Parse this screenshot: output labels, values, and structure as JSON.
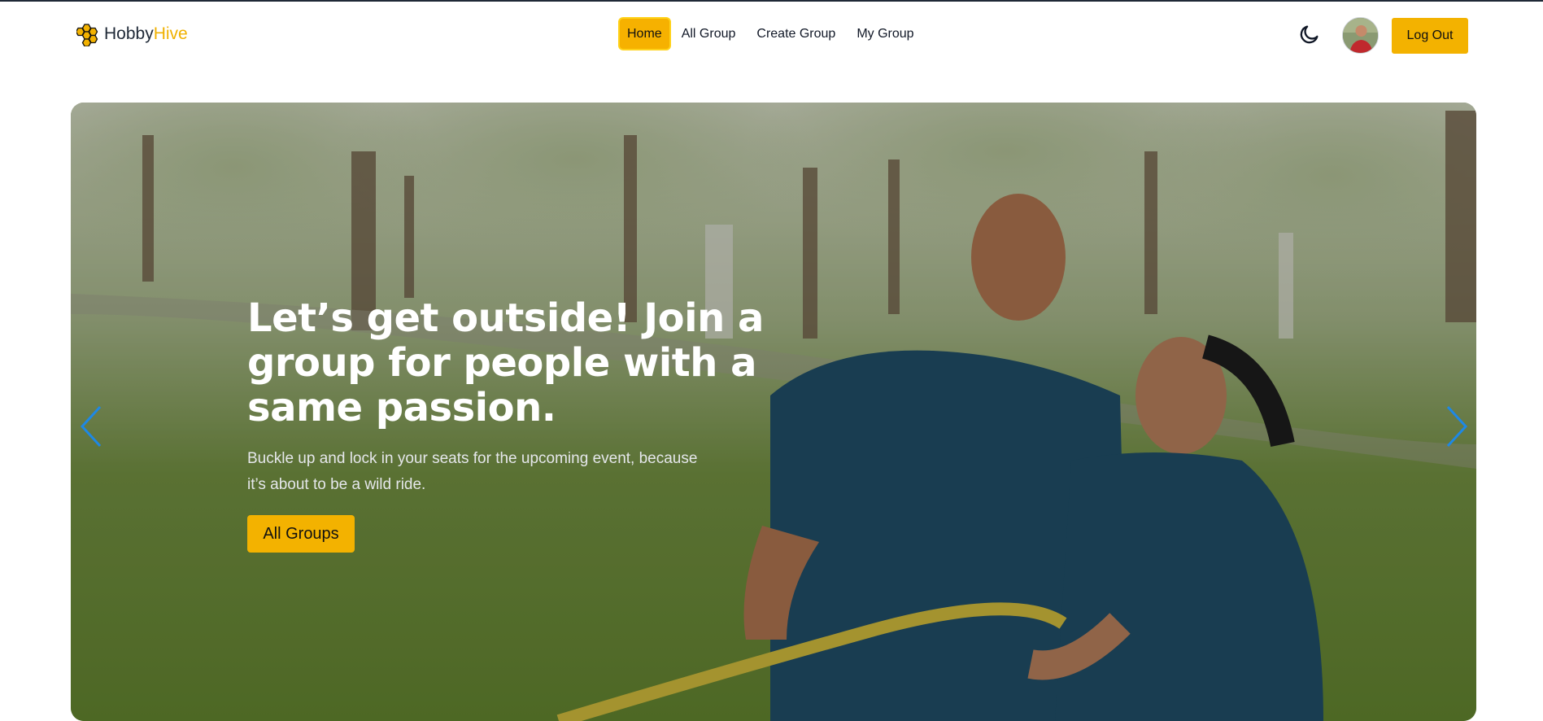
{
  "brand": {
    "name_part1": "Hobby",
    "name_part2": "Hive"
  },
  "nav": {
    "items": [
      {
        "label": "Home",
        "active": true
      },
      {
        "label": "All Group",
        "active": false
      },
      {
        "label": "Create Group",
        "active": false
      },
      {
        "label": "My Group",
        "active": false
      }
    ]
  },
  "header": {
    "logout_label": "Log Out",
    "theme_icon": "moon-icon",
    "avatar_icon": "user-avatar"
  },
  "hero": {
    "heading": "Let’s get outside! Join a group for people with a same passion.",
    "subtext": "Buckle up and lock in your seats for the upcoming event, because it’s about to be a wild ride.",
    "button_label": "All Groups",
    "prev_icon": "chevron-left-icon",
    "next_icon": "chevron-right-icon"
  },
  "colors": {
    "accent": "#f3b200",
    "arrow": "#1e88e5",
    "text_dark": "#111827"
  }
}
